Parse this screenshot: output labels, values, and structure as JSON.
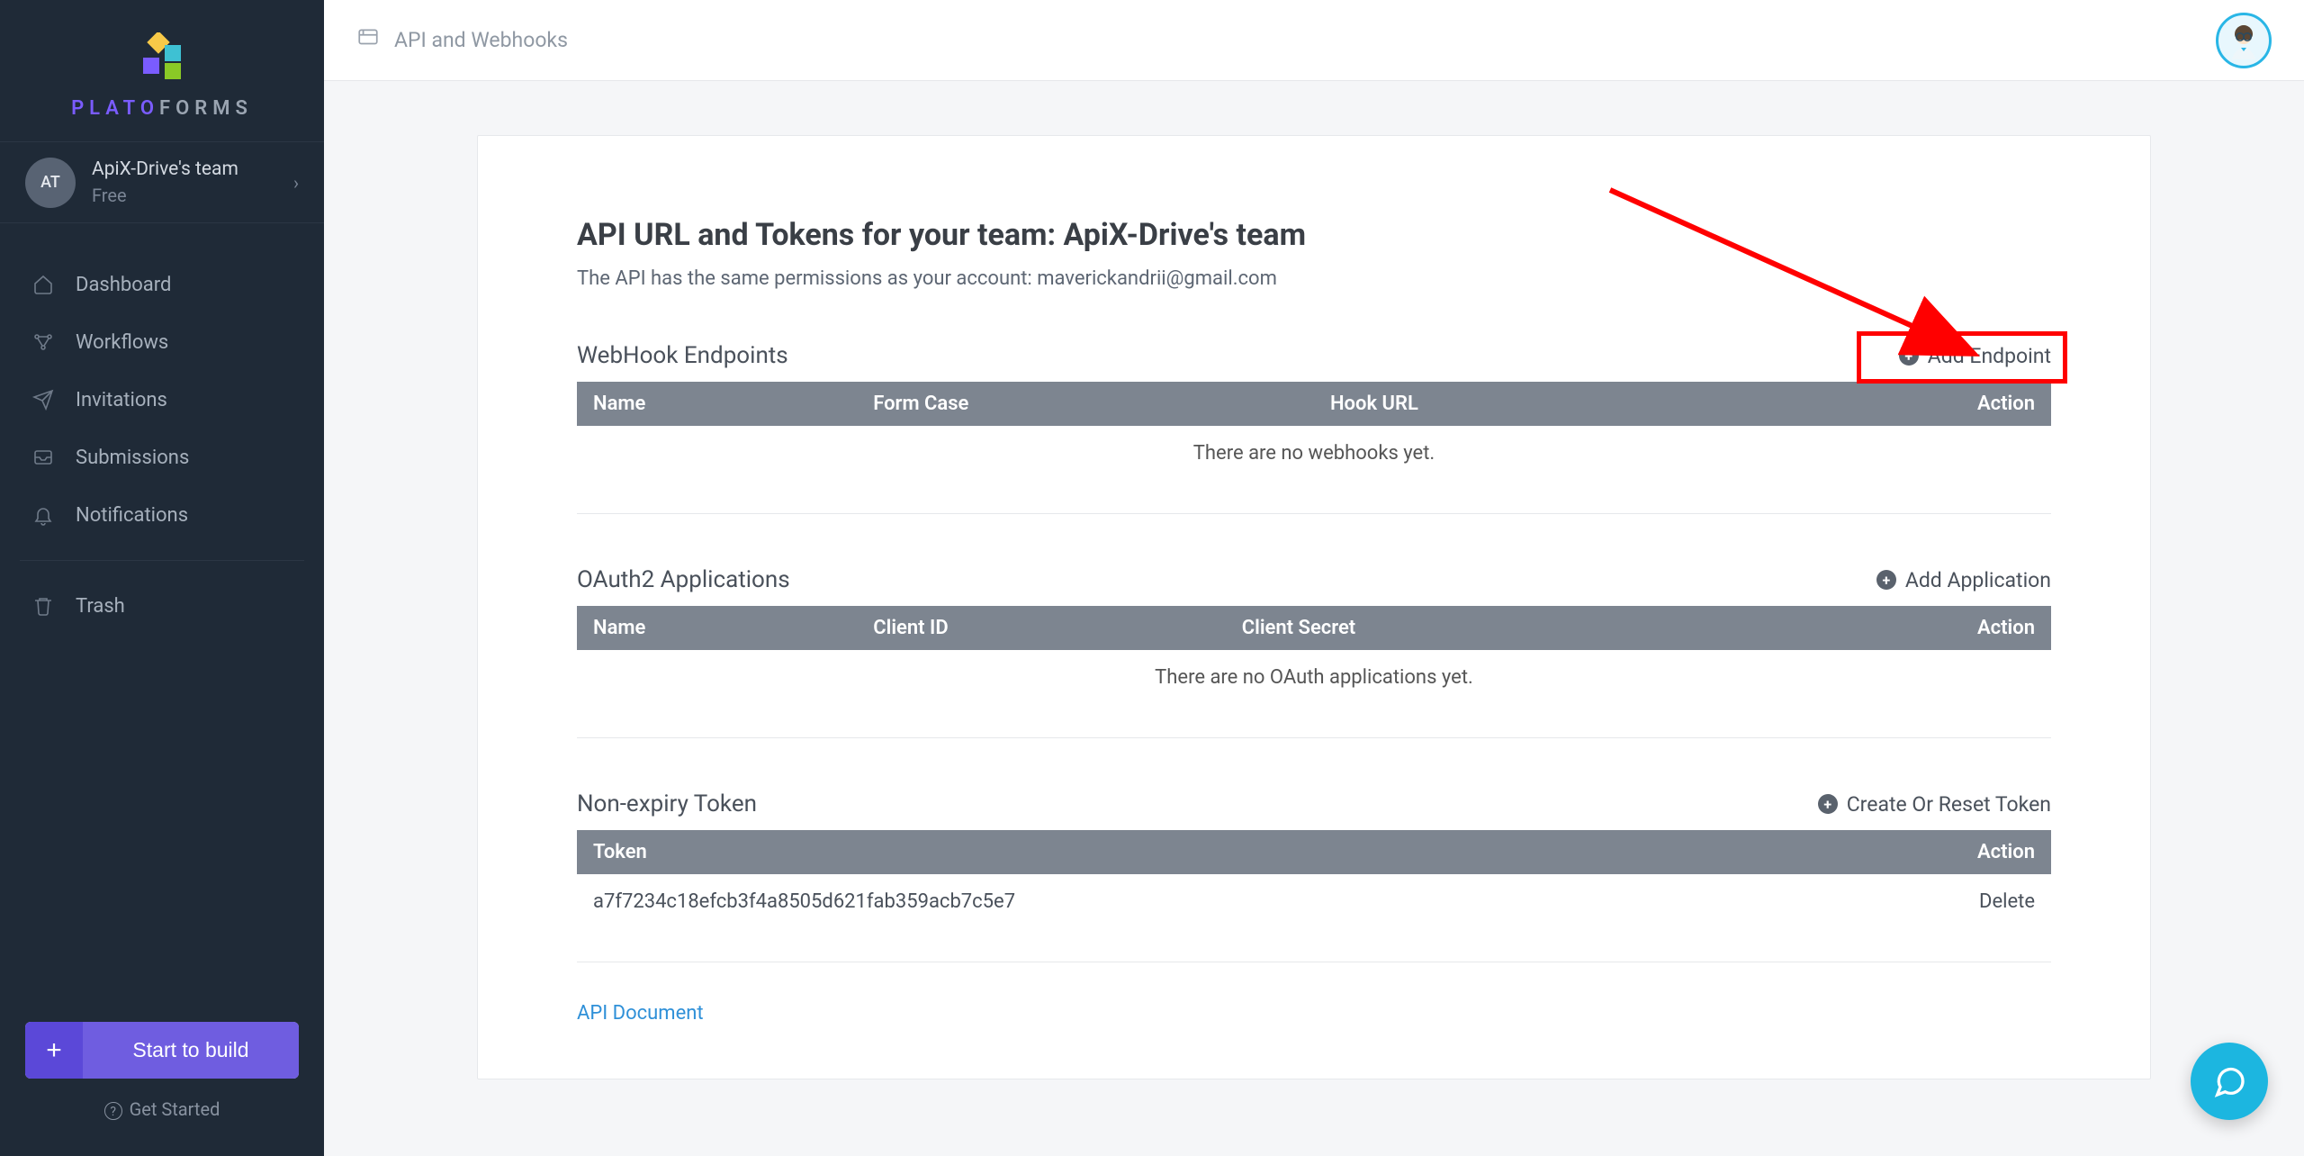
{
  "brand": {
    "part1": "PLATO",
    "part2": "FORMS"
  },
  "team": {
    "avatar_initials": "AT",
    "name": "ApiX-Drive's team",
    "plan": "Free"
  },
  "nav": {
    "dashboard": "Dashboard",
    "workflows": "Workflows",
    "invitations": "Invitations",
    "submissions": "Submissions",
    "notifications": "Notifications",
    "trash": "Trash"
  },
  "sidebar_cta": {
    "start_build": "Start to build",
    "get_started": "Get Started"
  },
  "breadcrumb": {
    "label": "API and Webhooks"
  },
  "page": {
    "title": "API URL and Tokens for your team: ApiX-Drive's team",
    "subtitle": "The API has the same permissions as your account: maverickandrii@gmail.com"
  },
  "webhooks": {
    "section_title": "WebHook Endpoints",
    "add_label": "Add Endpoint",
    "cols": {
      "name": "Name",
      "form_case": "Form Case",
      "hook_url": "Hook URL",
      "action": "Action"
    },
    "empty": "There are no webhooks yet."
  },
  "oauth": {
    "section_title": "OAuth2 Applications",
    "add_label": "Add Application",
    "cols": {
      "name": "Name",
      "client_id": "Client ID",
      "client_secret": "Client Secret",
      "action": "Action"
    },
    "empty": "There are no OAuth applications yet."
  },
  "token": {
    "section_title": "Non-expiry Token",
    "add_label": "Create Or Reset Token",
    "cols": {
      "token": "Token",
      "action": "Action"
    },
    "value": "a7f7234c18efcb3f4a8505d621fab359acb7c5e7",
    "delete_label": "Delete"
  },
  "api_doc_link": "API Document"
}
